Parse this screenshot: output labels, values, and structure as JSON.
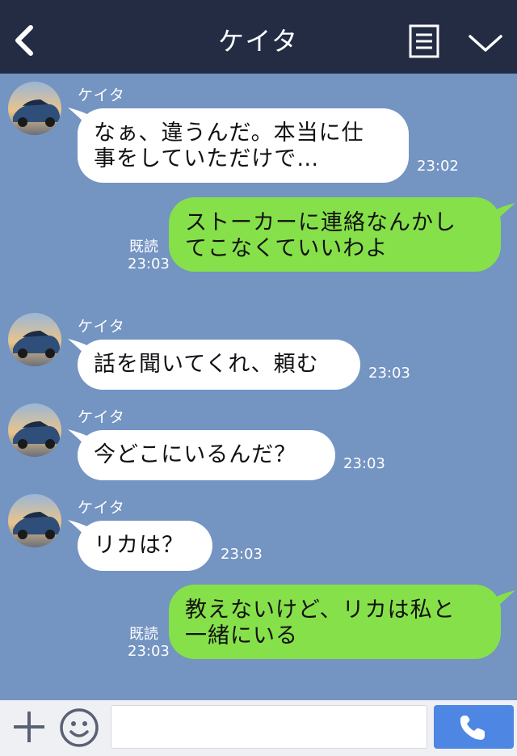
{
  "header": {
    "title": "ケイタ"
  },
  "messages": [
    {
      "direction": "in",
      "sender": "ケイタ",
      "text": "なぁ、違うんだ。本当に仕\n事をしていただけで…",
      "time": "23:02"
    },
    {
      "direction": "out",
      "text": "ストーカーに連絡なんかし\nてこなくていいわよ",
      "read": "既読",
      "time": "23:03"
    },
    {
      "direction": "in",
      "sender": "ケイタ",
      "text": "話を聞いてくれ、頼む",
      "time": "23:03"
    },
    {
      "direction": "in",
      "sender": "ケイタ",
      "text": "今どこにいるんだ？",
      "time": "23:03"
    },
    {
      "direction": "in",
      "sender": "ケイタ",
      "text": "リカは？",
      "time": "23:03"
    },
    {
      "direction": "out",
      "text": "教えないけど、リカは私と\n一緒にいる",
      "read": "既読",
      "time": "23:03"
    }
  ],
  "footer": {
    "input_value": ""
  },
  "icons": {
    "back": "back-chevron-icon",
    "menu": "menu-icon",
    "dropdown": "chevron-down-icon",
    "add": "plus-icon",
    "emoji": "emoji-icon",
    "call": "phone-icon"
  },
  "colors": {
    "header": "#232c43",
    "chat_background": "#7494c2",
    "incoming_bubble": "#ffffff",
    "outgoing_bubble": "#86e04a",
    "call_button": "#4e86e3",
    "footer": "#eef0f4"
  }
}
